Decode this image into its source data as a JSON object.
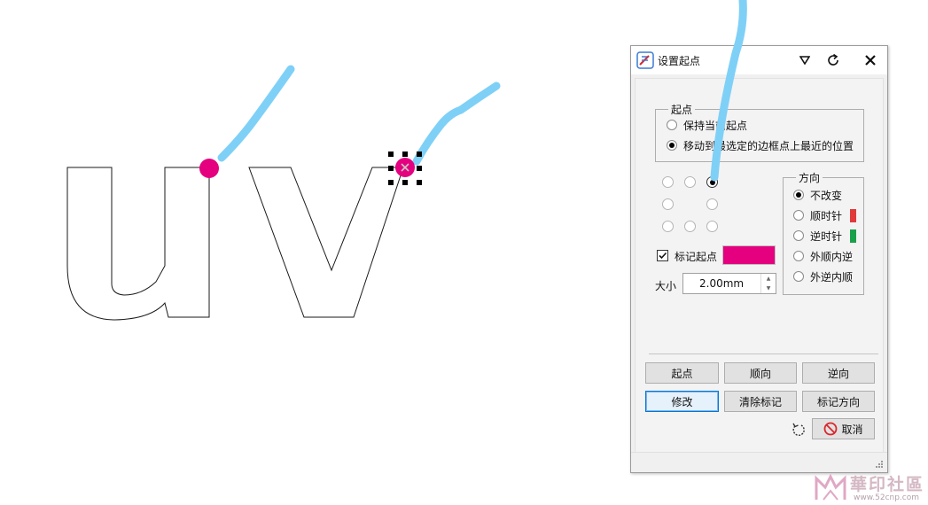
{
  "dialog": {
    "title": "设置起点",
    "start_group": {
      "legend": "起点",
      "options": [
        {
          "label": "保持当前起点",
          "checked": false
        },
        {
          "label": "移动到最选定的边框点上最近的位置",
          "checked": true
        }
      ]
    },
    "position_grid": {
      "rows": [
        [
          false,
          false,
          true
        ],
        [
          false,
          null,
          false
        ],
        [
          false,
          false,
          false
        ]
      ]
    },
    "direction_group": {
      "legend": "方向",
      "options": [
        {
          "label": "不改变",
          "checked": true,
          "color": ""
        },
        {
          "label": "顺时针",
          "checked": false,
          "color": "#e03a3a"
        },
        {
          "label": "逆时针",
          "checked": false,
          "color": "#1aa04a"
        },
        {
          "label": "外顺内逆",
          "checked": false,
          "color": ""
        },
        {
          "label": "外逆内顺",
          "checked": false,
          "color": ""
        }
      ]
    },
    "mark_start": {
      "label": "标记起点",
      "checked": true,
      "color": "#e4007f"
    },
    "size": {
      "label": "大小",
      "value": "2.00mm"
    },
    "buttons": {
      "start": "起点",
      "forward": "顺向",
      "reverse": "逆向",
      "modify": "修改",
      "clear_marks": "清除标记",
      "mark_direction": "标记方向",
      "cancel": "取消"
    }
  },
  "canvas": {
    "letters": [
      "u",
      "v"
    ],
    "start_marker_color": "#e4007f",
    "annotation_stroke_color": "#7fd0f7"
  },
  "watermark": {
    "text": "華印社區",
    "url": "www.52cnp.com"
  }
}
